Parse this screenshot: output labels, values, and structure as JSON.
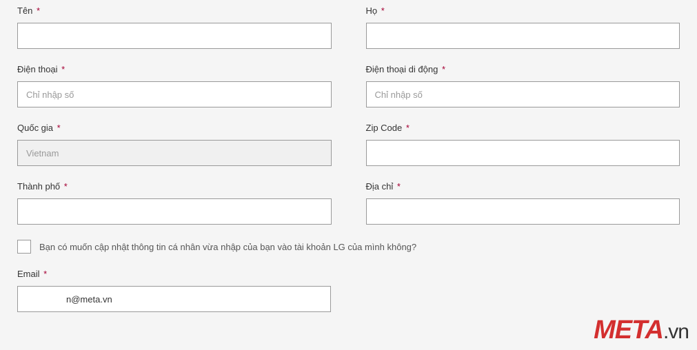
{
  "form": {
    "firstName": {
      "label": "Tên",
      "value": ""
    },
    "lastName": {
      "label": "Họ",
      "value": ""
    },
    "phone": {
      "label": "Điện thoại",
      "placeholder": "Chỉ nhập số",
      "value": ""
    },
    "mobile": {
      "label": "Điện thoại di động",
      "placeholder": "Chỉ nhập số",
      "value": ""
    },
    "country": {
      "label": "Quốc gia",
      "value": "Vietnam"
    },
    "zipCode": {
      "label": "Zip Code",
      "value": ""
    },
    "city": {
      "label": "Thành phố",
      "value": ""
    },
    "address": {
      "label": "Địa chỉ",
      "value": ""
    },
    "updateCheckbox": {
      "label": "Bạn có muốn cập nhật thông tin cá nhân vừa nhập của bạn vào tài khoản LG của mình không?"
    },
    "email": {
      "label": "Email",
      "value": "n@meta.vn"
    }
  },
  "requiredMark": "*",
  "logo": {
    "meta": "META",
    "vn": ".vn"
  }
}
